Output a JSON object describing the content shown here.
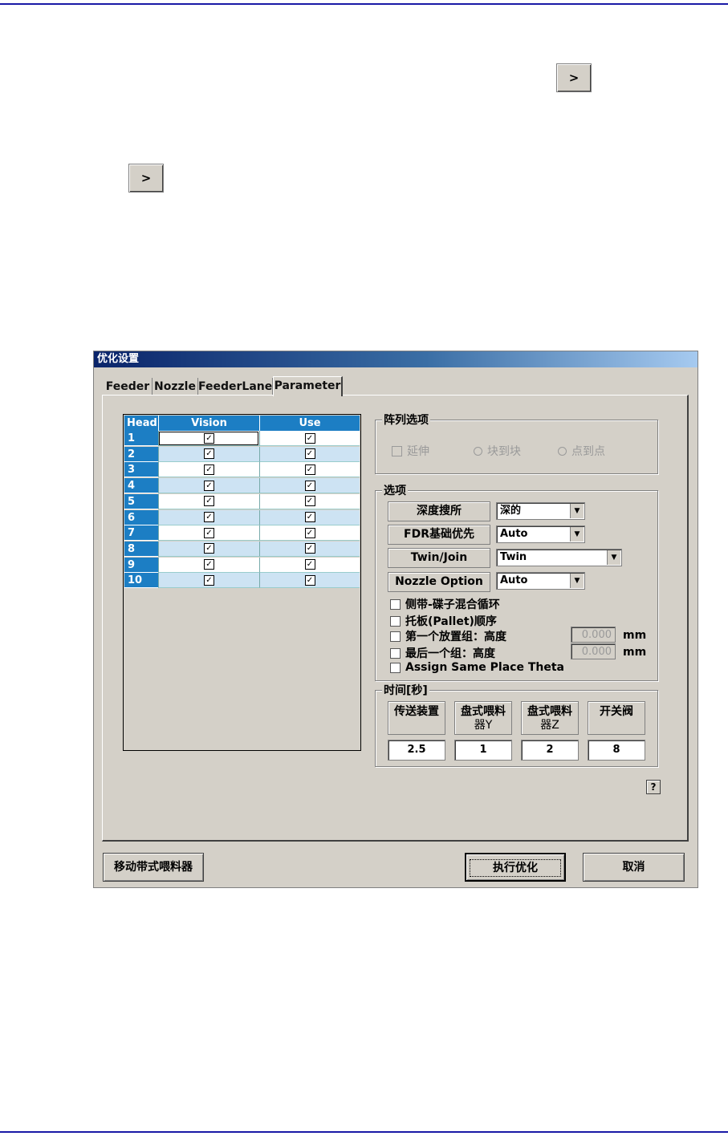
{
  "dialog": {
    "title": "优化设置",
    "tabs": [
      "Feeder",
      "Nozzle",
      "FeederLane",
      "Parameter"
    ],
    "active_tab": "Parameter"
  },
  "head_table": {
    "columns": [
      "Head",
      "Vision",
      "Use"
    ],
    "rows": [
      {
        "head": "1",
        "vision": "✓",
        "use": "✓"
      },
      {
        "head": "2",
        "vision": "✓",
        "use": "✓"
      },
      {
        "head": "3",
        "vision": "✓",
        "use": "✓"
      },
      {
        "head": "4",
        "vision": "✓",
        "use": "✓"
      },
      {
        "head": "5",
        "vision": "✓",
        "use": "✓"
      },
      {
        "head": "6",
        "vision": "✓",
        "use": "✓"
      },
      {
        "head": "7",
        "vision": "✓",
        "use": "✓"
      },
      {
        "head": "8",
        "vision": "✓",
        "use": "✓"
      },
      {
        "head": "9",
        "vision": "✓",
        "use": "✓"
      },
      {
        "head": "10",
        "vision": "✓",
        "use": "✓"
      }
    ]
  },
  "array_options": {
    "title": "阵列选项",
    "extend_label": "延伸",
    "block_to_block_label": "块到块",
    "point_to_point_label": "点到点"
  },
  "options": {
    "title": "选项",
    "depth_search_label": "深度搜所",
    "depth_search_value": "深的",
    "fdr_priority_label": "FDR基础优先",
    "fdr_priority_value": "Auto",
    "twin_join_label": "Twin/Join",
    "twin_join_value": "Twin",
    "nozzle_option_label": "Nozzle Option",
    "nozzle_option_value": "Auto",
    "checks": [
      "侧带-碟子混合循环",
      "托板(Pallet)顺序",
      "第一个放置组：高度",
      "最后一个组：高度",
      "Assign Same Place Theta"
    ],
    "first_height": "0.000",
    "last_height": "0.000",
    "unit": "mm"
  },
  "time": {
    "title": "时间[秒]",
    "labels": [
      "传送装置",
      "盘式喂料\n器Y",
      "盘式喂料\n器Z",
      "开关阀"
    ],
    "values": [
      "2.5",
      "1",
      "2",
      "8"
    ]
  },
  "buttons": {
    "move_feeder": "移动带式喂料器",
    "run": "执行优化",
    "cancel": "取消",
    "help": "?"
  },
  "nav_buttons": [
    ">",
    ">"
  ]
}
